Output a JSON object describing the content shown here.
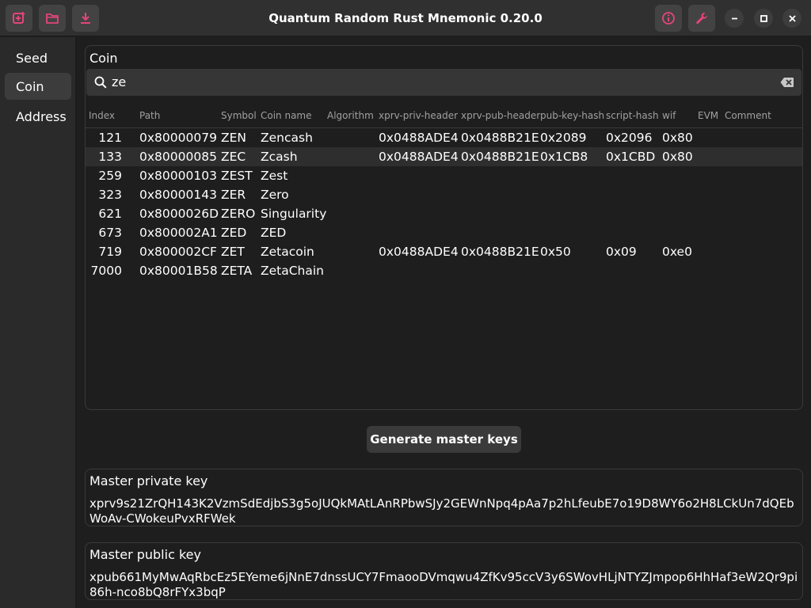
{
  "app": {
    "title": "Quantum Random Rust Mnemonic 0.20.0"
  },
  "colors": {
    "accent": "#e5447a",
    "background": "#1e1e1e",
    "headerbar": "#303030"
  },
  "header": {
    "left_buttons": [
      "new-icon",
      "open-folder-icon",
      "download-icon"
    ],
    "right_buttons": [
      "info-icon",
      "wrench-icon"
    ],
    "window_controls": [
      "minimize-icon",
      "maximize-icon",
      "close-icon"
    ]
  },
  "sidebar": {
    "items": [
      {
        "label": "Seed",
        "active": false
      },
      {
        "label": "Coin",
        "active": true
      },
      {
        "label": "Address",
        "active": false
      }
    ]
  },
  "coin": {
    "label": "Coin",
    "search": {
      "value": "ze",
      "icon": "search-icon",
      "clear_icon": "clear-icon"
    },
    "columns": [
      "Index",
      "Path",
      "Symbol",
      "Coin name",
      "Algorithm",
      "xprv-priv-header",
      "xprv-pub-header",
      "pub-key-hash",
      "script-hash",
      "wif",
      "EVM",
      "Comment"
    ],
    "rows": [
      {
        "index": "121",
        "path": "0x80000079",
        "symbol": "ZEN",
        "name": "Zencash",
        "algorithm": "",
        "xprv_priv": "0x0488ADE4",
        "xprv_pub": "0x0488B21E",
        "pkh": "0x2089",
        "sh": "0x2096",
        "wif": "0x80",
        "evm": "",
        "comment": "",
        "selected": false
      },
      {
        "index": "133",
        "path": "0x80000085",
        "symbol": "ZEC",
        "name": "Zcash",
        "algorithm": "",
        "xprv_priv": "0x0488ADE4",
        "xprv_pub": "0x0488B21E",
        "pkh": "0x1CB8",
        "sh": "0x1CBD",
        "wif": "0x80",
        "evm": "",
        "comment": "",
        "selected": true
      },
      {
        "index": "259",
        "path": "0x80000103",
        "symbol": "ZEST",
        "name": "Zest",
        "algorithm": "",
        "xprv_priv": "",
        "xprv_pub": "",
        "pkh": "",
        "sh": "",
        "wif": "",
        "evm": "",
        "comment": "",
        "selected": false
      },
      {
        "index": "323",
        "path": "0x80000143",
        "symbol": "ZER",
        "name": "Zero",
        "algorithm": "",
        "xprv_priv": "",
        "xprv_pub": "",
        "pkh": "",
        "sh": "",
        "wif": "",
        "evm": "",
        "comment": "",
        "selected": false
      },
      {
        "index": "621",
        "path": "0x8000026D",
        "symbol": "ZERO",
        "name": "Singularity",
        "algorithm": "",
        "xprv_priv": "",
        "xprv_pub": "",
        "pkh": "",
        "sh": "",
        "wif": "",
        "evm": "",
        "comment": "",
        "selected": false
      },
      {
        "index": "673",
        "path": "0x800002A1",
        "symbol": "ZED",
        "name": "ZED",
        "algorithm": "",
        "xprv_priv": "",
        "xprv_pub": "",
        "pkh": "",
        "sh": "",
        "wif": "",
        "evm": "",
        "comment": "",
        "selected": false
      },
      {
        "index": "719",
        "path": "0x800002CF",
        "symbol": "ZET",
        "name": "Zetacoin",
        "algorithm": "",
        "xprv_priv": "0x0488ADE4",
        "xprv_pub": "0x0488B21E",
        "pkh": "0x50",
        "sh": "0x09",
        "wif": "0xe0",
        "evm": "",
        "comment": "",
        "selected": false
      },
      {
        "index": "7000",
        "path": "0x80001B58",
        "symbol": "ZETA",
        "name": "ZetaChain",
        "algorithm": "",
        "xprv_priv": "",
        "xprv_pub": "",
        "pkh": "",
        "sh": "",
        "wif": "",
        "evm": "",
        "comment": "",
        "selected": false
      }
    ]
  },
  "actions": {
    "generate_label": "Generate master keys"
  },
  "keys": {
    "private_label": "Master private key",
    "private_value": "xprv9s21ZrQH143K2VzmSdEdjbS3g5oJUQkMAtLAnRPbwSJy2GEWnNpq4pAa7p2hLfeubE7o19D8WY6o2H8LCkUn7dQEbWoAv-CWokeuPvxRFWek",
    "public_label": "Master public key",
    "public_value": "xpub661MyMwAqRbcEz5EYeme6jNnE7dnssUCY7FmaooDVmqwu4ZfKv95ccV3y6SWovHLjNTYZJmpop6HhHaf3eW2Qr9pi86h-nco8bQ8rFYx3bqP"
  }
}
